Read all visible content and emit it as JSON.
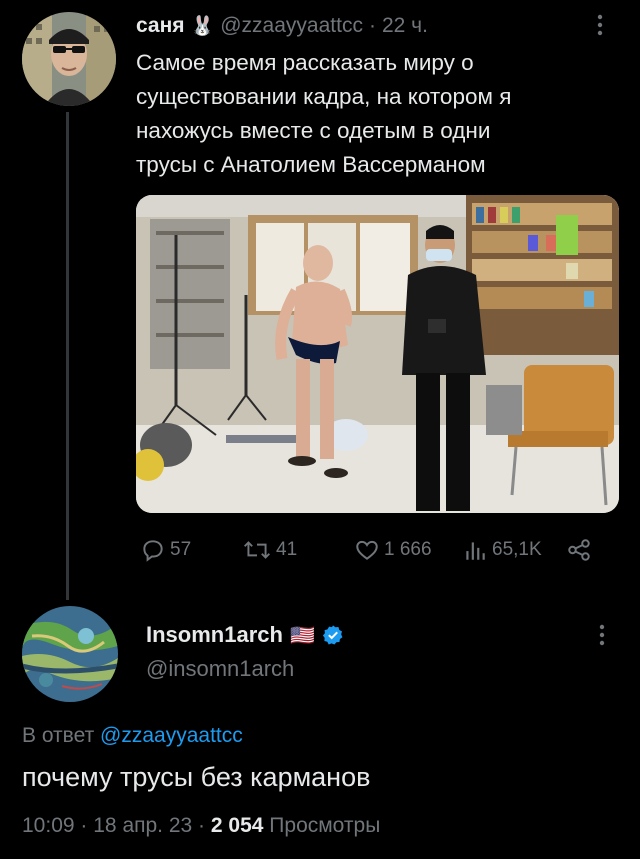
{
  "tweet": {
    "author": {
      "name": "саня",
      "emoji": "🐰",
      "handle": "@zzaayyaattcc",
      "separator": "·",
      "time": "22 ч."
    },
    "text_lines": [
      "Самое время рассказать миру о",
      "существовании кадра, на котором я",
      "нахожусь вместе с одетым в одни",
      "трусы с Анатолием Вассерманом"
    ],
    "actions": {
      "replies": "57",
      "retweets": "41",
      "likes": "1 666",
      "views": "65,1K"
    },
    "icons": [
      "reply-icon",
      "retweet-icon",
      "like-icon",
      "views-icon",
      "share-icon",
      "more-icon"
    ]
  },
  "reply": {
    "author": {
      "name": "Insomn1arch",
      "flag": "🇺🇸",
      "handle": "@insomn1arch"
    },
    "reply_to_label": "В ответ",
    "reply_to_handle": "@zzaayyaattcc",
    "text": "почему трусы без карманов",
    "meta": {
      "time": "10:09",
      "separator1": "·",
      "date": "18 апр. 23",
      "separator2": "·",
      "views_count": "2 054",
      "views_label": "Просмотры"
    }
  },
  "colors": {
    "background": "#000000",
    "text": "#e7e9ea",
    "muted": "#71767b",
    "accent": "#1d9bf0",
    "thread_line": "#333639"
  }
}
